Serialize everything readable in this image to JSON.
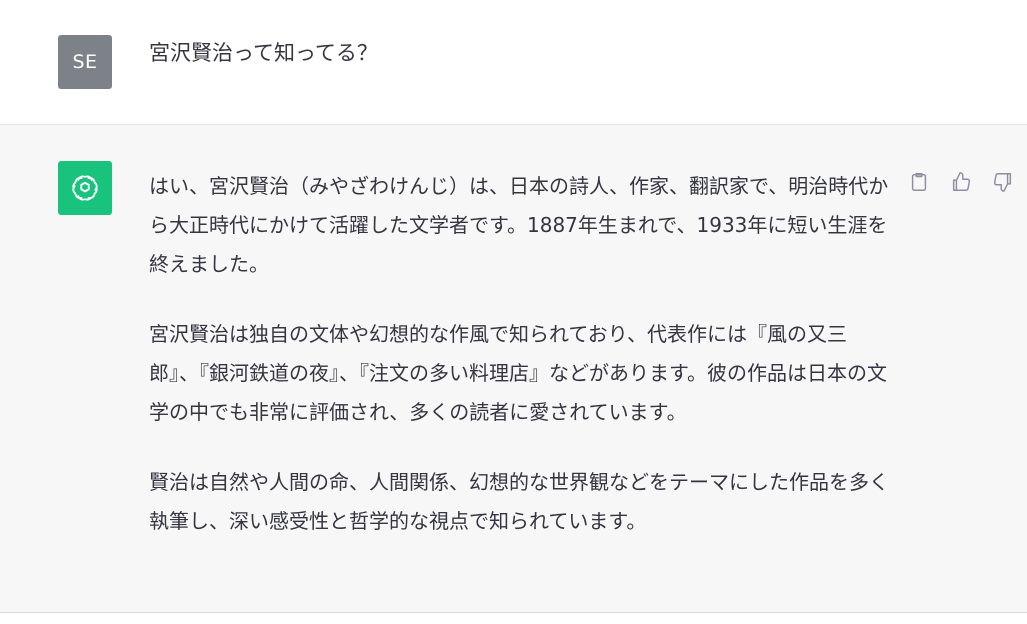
{
  "user_message": {
    "avatar_initials": "SE",
    "text": "宮沢賢治って知ってる？"
  },
  "assistant_message": {
    "avatar_icon": "openai-logo-icon",
    "paragraphs": [
      "はい、宮沢賢治（みやざわけんじ）は、日本の詩人、作家、翻訳家で、明治時代から大正時代にかけて活躍した文学者です。1887年生まれで、1933年に短い生涯を終えました。",
      "宮沢賢治は独自の文体や幻想的な作風で知られており、代表作には『風の又三郎』、『銀河鉄道の夜』、『注文の多い料理店』などがあります。彼の作品は日本の文学の中でも非常に評価され、多くの読者に愛されています。",
      "賢治は自然や人間の命、人間関係、幻想的な世界観などをテーマにした作品を多く執筆し、深い感受性と哲学的な視点で知られています。"
    ],
    "actions": [
      "copy-icon",
      "thumbs-up-icon",
      "thumbs-down-icon"
    ]
  },
  "colors": {
    "user_avatar_bg": "#7d8288",
    "assistant_avatar_bg": "#19c37d",
    "assistant_row_bg": "#f7f7f8",
    "text": "#343541",
    "icon": "#8e8ea0"
  }
}
